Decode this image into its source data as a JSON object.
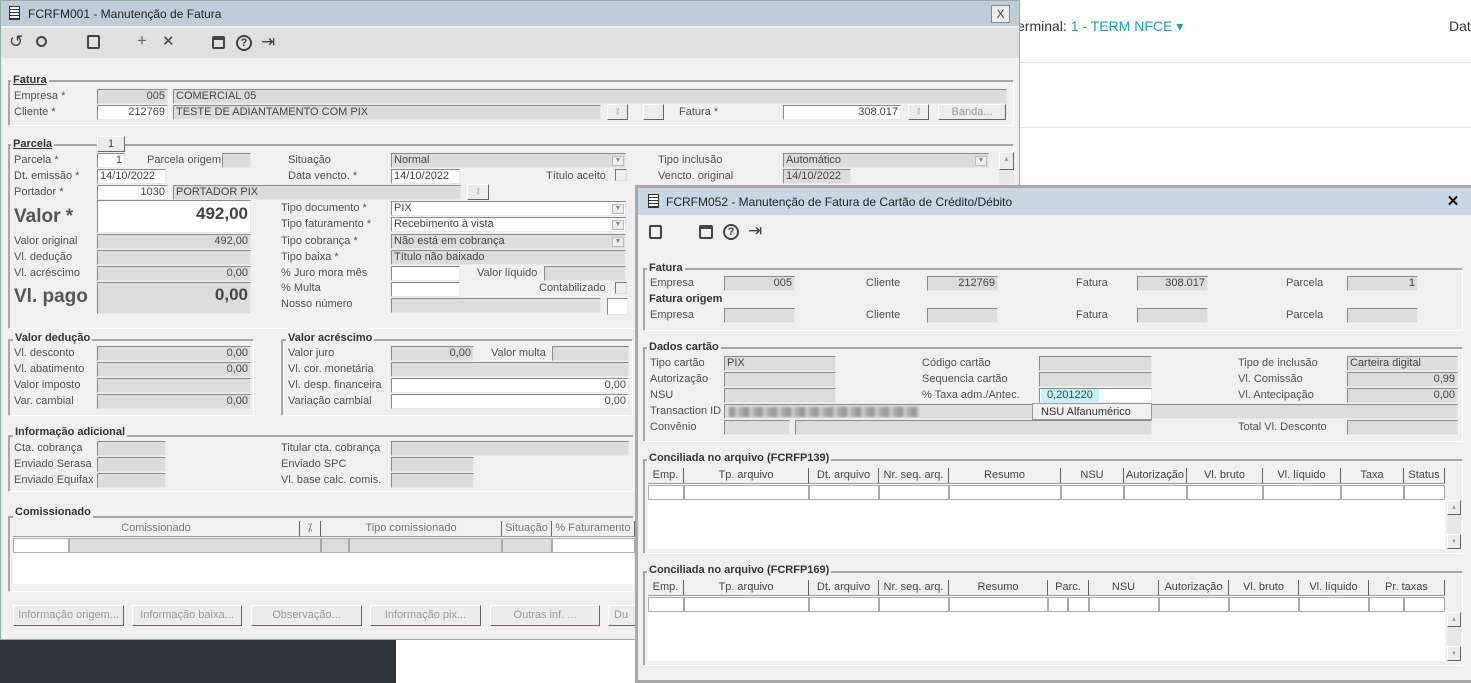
{
  "background": {
    "terminal_label": "erminal:",
    "terminal_value": "1 - TERM NFCE",
    "terminal_caret": "▾",
    "date_label": "Dat"
  },
  "win1": {
    "title": "FCRFM001 - Manutenção de Fatura",
    "close": "X",
    "toolbar": {
      "undo": "↺",
      "search": "🔍",
      "save": "💾",
      "add": "+",
      "delete": "✕",
      "calendar": "📅",
      "help": "?",
      "exit": "⇥"
    },
    "fatura": {
      "legend": "Fatura",
      "empresa_label": "Empresa *",
      "empresa_code": "005",
      "empresa_name": "COMERCIAL 05",
      "cliente_label": "Cliente *",
      "cliente_code": "212769",
      "cliente_name": "TESTE DE ADIANTAMENTO COM PIX",
      "fatura_label": "Fatura *",
      "fatura_value": "308.017",
      "banda": "Banda..."
    },
    "parcela": {
      "legend": "Parcela",
      "tab": "1",
      "parcela_label": "Parcela *",
      "parcela_value": "1",
      "parcela_origem_label": "Parcela origem",
      "dt_emissao_label": "Dt. emissão *",
      "dt_emissao": "14/10/2022",
      "portador_label": "Portador *",
      "portador_code": "1030",
      "portador_name": "PORTADOR PIX",
      "valor_label": "Valor *",
      "valor": "492,00",
      "valor_original_label": "Valor original",
      "valor_original": "492,00",
      "vl_deducao_label": "Vl. dedução",
      "vl_acrescimo_label": "Vl. acréscimo",
      "vl_acrescimo": "0,00",
      "vl_pago_label": "Vl. pago",
      "vl_pago": "0,00",
      "situacao_label": "Situação",
      "situacao": "Normal",
      "data_vencto_label": "Data vencto. *",
      "data_vencto": "14/10/2022",
      "titulo_aceito_label": "Título aceito",
      "tipo_documento_label": "Tipo documento *",
      "tipo_documento": "PIX",
      "tipo_faturamento_label": "Tipo faturamento *",
      "tipo_faturamento": "Recebimento à vista",
      "tipo_cobranca_label": "Tipo cobrança *",
      "tipo_cobranca": "Não está em cobrança",
      "tipo_baixa_label": "Tipo baixa *",
      "tipo_baixa": "Título não baixado",
      "juro_label": "% Juro mora mês",
      "valor_liquido_label": "Valor líquido",
      "multa_label": "% Multa",
      "contabilizado_label": "Contabilizado",
      "nosso_numero_label": "Nosso número",
      "tipo_inclusao_label": "Tipo inclusão",
      "tipo_inclusao": "Automático",
      "vencto_original_label": "Vencto. original",
      "vencto_original": "14/10/2022"
    },
    "deducao": {
      "legend": "Valor dedução",
      "desconto_label": "Vl. desconto",
      "desconto": "0,00",
      "abatimento_label": "Vl. abatimento",
      "abatimento": "0,00",
      "imposto_label": "Valor imposto",
      "cambial_label": "Var. cambial",
      "cambial": "0,00"
    },
    "acrescimo": {
      "legend": "Valor acréscimo",
      "juro_label": "Valor juro",
      "juro": "0,00",
      "multa_label": "Valor multa",
      "cor_label": "Vl. cor. monetária",
      "desp_label": "Vl. desp. financeira",
      "desp": "0,00",
      "var_label": "Variação cambial",
      "var": "0,00"
    },
    "adicional": {
      "legend": "Informação adicional",
      "cta_label": "Cta. cobrança",
      "serasa_label": "Enviado Serasa",
      "equifax_label": "Enviado Equifax",
      "titular_label": "Titular cta. cobrança",
      "spc_label": "Enviado SPC",
      "base_label": "Vl. base calc. comis."
    },
    "comissionado": {
      "legend": "Comissionado",
      "columns": [
        "Comissionado",
        "",
        "Tipo comissionado",
        "Situação",
        "% Faturamento"
      ]
    },
    "buttons": [
      "Informação origem...",
      "Informação baixa...",
      "Observação...",
      "Informação pix...",
      "Outras inf. ...",
      "Du"
    ]
  },
  "win2": {
    "title": "FCRFM052 - Manutenção de Fatura de Cartão de Crédito/Débito",
    "close": "✕",
    "toolbar": {
      "save": "💾",
      "calendar": "📅",
      "help": "?",
      "exit": "⇥"
    },
    "fatura": {
      "legend": "Fatura",
      "empresa_label": "Empresa",
      "empresa": "005",
      "cliente_label": "Cliente",
      "cliente": "212769",
      "fatura_label": "Fatura",
      "fatura": "308.017",
      "parcela_label": "Parcela",
      "parcela": "1"
    },
    "origem": {
      "legend": "Fatura origem",
      "empresa_label": "Empresa",
      "cliente_label": "Cliente",
      "fatura_label": "Fatura",
      "parcela_label": "Parcela"
    },
    "cartao": {
      "legend": "Dados cartão",
      "tipo_label": "Tipo cartão",
      "tipo": "PIX",
      "aut_label": "Autorização",
      "nsu_label": "NSU",
      "tid_label": "Transaction ID",
      "convenio_label": "Convênio",
      "codigo_label": "Código cartão",
      "seq_label": "Sequencia cartão",
      "taxa_label": "% Taxa adm./Antec.",
      "taxa": "0,201220",
      "inclusao_label": "Tipo de inclusão",
      "inclusao": "Carteira digital",
      "comissao_label": "Vl. Comissão",
      "comissao": "0,99",
      "antecipacao_label": "Vl. Antecipação",
      "antecipacao": "0,00",
      "desconto_label": "Total Vl. Desconto",
      "popup": "NSU Alfanumérico"
    },
    "t139": {
      "legend": "Conciliada no arquivo (FCRFP139)",
      "columns": [
        "Emp.",
        "Tp. arquivo",
        "Dt. arquivo",
        "Nr. seq. arq.",
        "Resumo",
        "NSU",
        "Autorização",
        "Vl. bruto",
        "Vl. líquido",
        "Taxa",
        "Status"
      ]
    },
    "t169": {
      "legend": "Conciliada no arquivo (FCRFP169)",
      "columns": [
        "Emp.",
        "Tp. arquivo",
        "Dt. arquivo",
        "Nr. seq. arq.",
        "Resumo",
        "Parc.",
        "NSU",
        "Autorização",
        "Vl. bruto",
        "Vl. líquido",
        "Pr. taxas"
      ]
    }
  }
}
